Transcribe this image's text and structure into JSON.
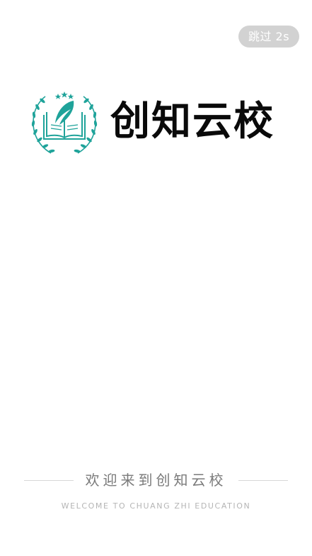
{
  "skip": {
    "label": "跳过 2s"
  },
  "brand": {
    "name": "创知云校",
    "accent_color": "#1fa39a",
    "emblem_icon": "book-quill-laurel-icon"
  },
  "welcome": {
    "text": "欢迎来到创知云校",
    "subtitle": "WELCOME TO CHUANG ZHI EDUCATION"
  }
}
